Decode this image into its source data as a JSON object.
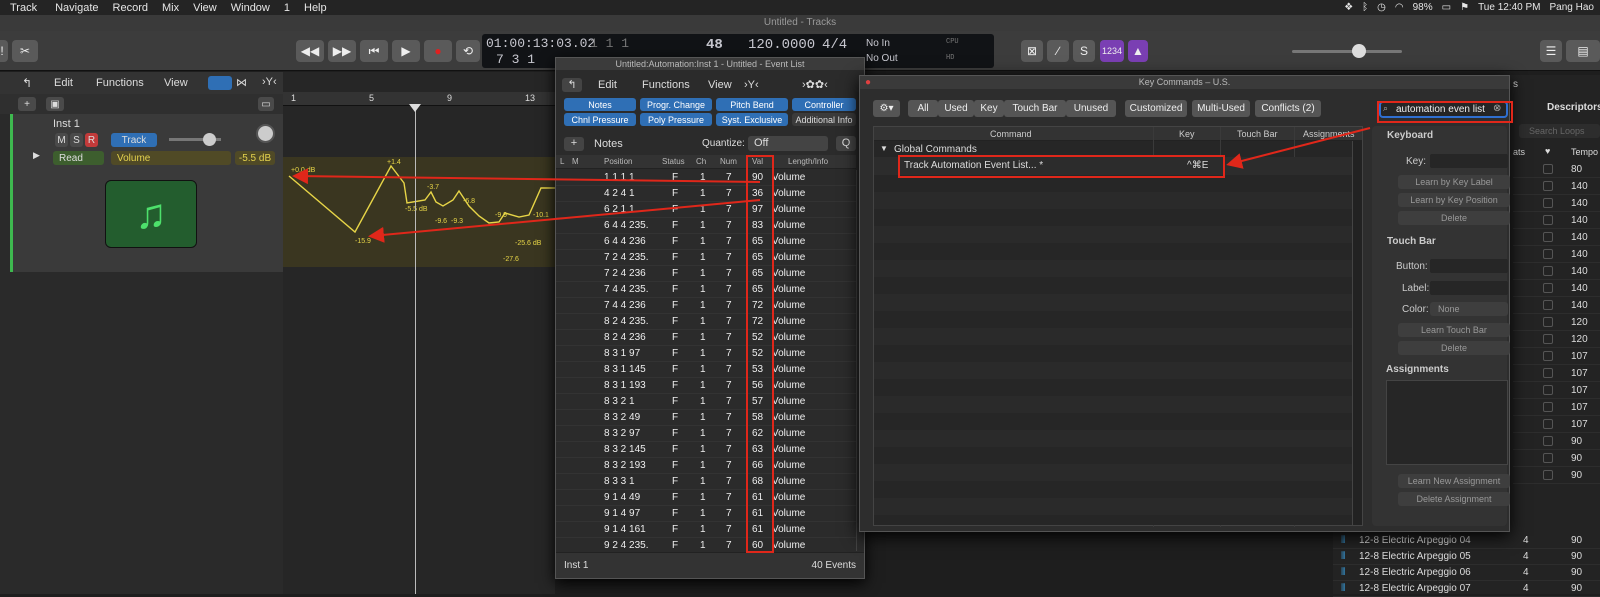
{
  "menubar": {
    "items": [
      "Track",
      "Navigate",
      "Record",
      "Mix",
      "View",
      "Window",
      "1",
      "Help"
    ],
    "battery": "98%",
    "clock": "Tue 12:40 PM",
    "user": "Pang Hao"
  },
  "window_title": "Untitled - Tracks",
  "transport": {
    "time": "01:00:13:03.02",
    "bars": "7 3 1",
    "bar_pos": "1 1 1",
    "tempo": "48",
    "tempo2": "120.0000",
    "sig": "4/4",
    "in": "No In",
    "out": "No Out",
    "cpu": "CPU",
    "hd": "HD",
    "count": "1234"
  },
  "tracks_header": {
    "edit": "Edit",
    "functions": "Functions",
    "view": "View"
  },
  "ruler": [
    "1",
    "5",
    "9",
    "13"
  ],
  "track": {
    "name": "Inst 1",
    "m": "M",
    "s": "S",
    "r": "R",
    "btn": "Track",
    "read": "Read",
    "param": "Volume",
    "db": "-5.5 dB"
  },
  "automation_labels": [
    "+0.0 dB",
    "+1.4",
    "-3.7",
    "-5.5 dB",
    "-6.8",
    "-9.6",
    "-9.3",
    "-9.9",
    "-10.1",
    "-15.9",
    "-25.6 dB",
    "-27.6"
  ],
  "event_list": {
    "title": "Untitled:Automation:Inst 1 - Untitled - Event List",
    "edit": "Edit",
    "functions": "Functions",
    "view": "View",
    "tabs": [
      "Notes",
      "Progr. Change",
      "Pitch Bend",
      "Controller",
      "Chnl Pressure",
      "Poly Pressure",
      "Syst. Exclusive",
      "Additional Info"
    ],
    "notes_label": "Notes",
    "quantize": "Quantize:",
    "quantize_val": "Off",
    "q": "Q",
    "columns": [
      "L",
      "M",
      "Position",
      "Status",
      "Ch",
      "Num",
      "Val",
      "Length/Info"
    ],
    "rows": [
      [
        "1 1 1    1",
        "F",
        "1",
        "7",
        "90",
        "Volume"
      ],
      [
        "4 2 4    1",
        "F",
        "1",
        "7",
        "36",
        "Volume"
      ],
      [
        "6 2 1    1",
        "F",
        "1",
        "7",
        "97",
        "Volume"
      ],
      [
        "6 4 4 235.",
        "F",
        "1",
        "7",
        "83",
        "Volume"
      ],
      [
        "6 4 4 236",
        "F",
        "1",
        "7",
        "65",
        "Volume"
      ],
      [
        "7 2 4 235.",
        "F",
        "1",
        "7",
        "65",
        "Volume"
      ],
      [
        "7 2 4 236",
        "F",
        "1",
        "7",
        "65",
        "Volume"
      ],
      [
        "7 4 4 235.",
        "F",
        "1",
        "7",
        "65",
        "Volume"
      ],
      [
        "7 4 4 236",
        "F",
        "1",
        "7",
        "72",
        "Volume"
      ],
      [
        "8 2 4 235.",
        "F",
        "1",
        "7",
        "72",
        "Volume"
      ],
      [
        "8 2 4 236",
        "F",
        "1",
        "7",
        "52",
        "Volume"
      ],
      [
        "8 3 1    97",
        "F",
        "1",
        "7",
        "52",
        "Volume"
      ],
      [
        "8 3 1 145",
        "F",
        "1",
        "7",
        "53",
        "Volume"
      ],
      [
        "8 3 1 193",
        "F",
        "1",
        "7",
        "56",
        "Volume"
      ],
      [
        "8 3 2    1",
        "F",
        "1",
        "7",
        "57",
        "Volume"
      ],
      [
        "8 3 2    49",
        "F",
        "1",
        "7",
        "58",
        "Volume"
      ],
      [
        "8 3 2    97",
        "F",
        "1",
        "7",
        "62",
        "Volume"
      ],
      [
        "8 3 2 145",
        "F",
        "1",
        "7",
        "63",
        "Volume"
      ],
      [
        "8 3 2 193",
        "F",
        "1",
        "7",
        "66",
        "Volume"
      ],
      [
        "8 3 3    1",
        "F",
        "1",
        "7",
        "68",
        "Volume"
      ],
      [
        "9 1 4    49",
        "F",
        "1",
        "7",
        "61",
        "Volume"
      ],
      [
        "9 1 4    97",
        "F",
        "1",
        "7",
        "61",
        "Volume"
      ],
      [
        "9 1 4 161",
        "F",
        "1",
        "7",
        "61",
        "Volume"
      ],
      [
        "9 2 4 235.",
        "F",
        "1",
        "7",
        "60",
        "Volume"
      ]
    ],
    "footer_left": "Inst 1",
    "footer_right": "40 Events"
  },
  "key_commands": {
    "title": "Key Commands – U.S.",
    "filters": [
      "All",
      "Used",
      "Key",
      "Touch Bar",
      "Unused",
      "Customized",
      "Multi-Used",
      "Conflicts (2)"
    ],
    "search": "automation even list",
    "columns": [
      "Command",
      "Key",
      "Touch Bar",
      "Assignments"
    ],
    "group": "Global Commands",
    "command": "Track Automation Event List... *",
    "command_key": "^⌘E",
    "right": {
      "keyboard": "Keyboard",
      "key": "Key:",
      "learn_label": "Learn by Key Label",
      "learn_pos": "Learn by Key Position",
      "delete": "Delete",
      "touch_bar": "Touch Bar",
      "button": "Button:",
      "label": "Label:",
      "color": "Color:",
      "color_val": "None",
      "learn_tb": "Learn Touch Bar",
      "delete2": "Delete",
      "assignments": "Assignments",
      "learn_new": "Learn New Assignment",
      "delete_assign": "Delete Assignment"
    }
  },
  "library": {
    "descriptors": "Descriptors",
    "s": "s",
    "search": "Search Loops",
    "beats": "ats",
    "tempo": "Tempo",
    "tempos": [
      "80",
      "140",
      "140",
      "140",
      "140",
      "140",
      "140",
      "140",
      "140",
      "120",
      "120",
      "107",
      "107",
      "107",
      "107",
      "107",
      "90",
      "90",
      "90"
    ],
    "loops": [
      [
        "12-8 Electric Arpeggio 04",
        "4",
        "90"
      ],
      [
        "12-8 Electric Arpeggio 05",
        "4",
        "90"
      ],
      [
        "12-8 Electric Arpeggio 06",
        "4",
        "90"
      ],
      [
        "12-8 Electric Arpeggio 07",
        "4",
        "90"
      ]
    ]
  }
}
